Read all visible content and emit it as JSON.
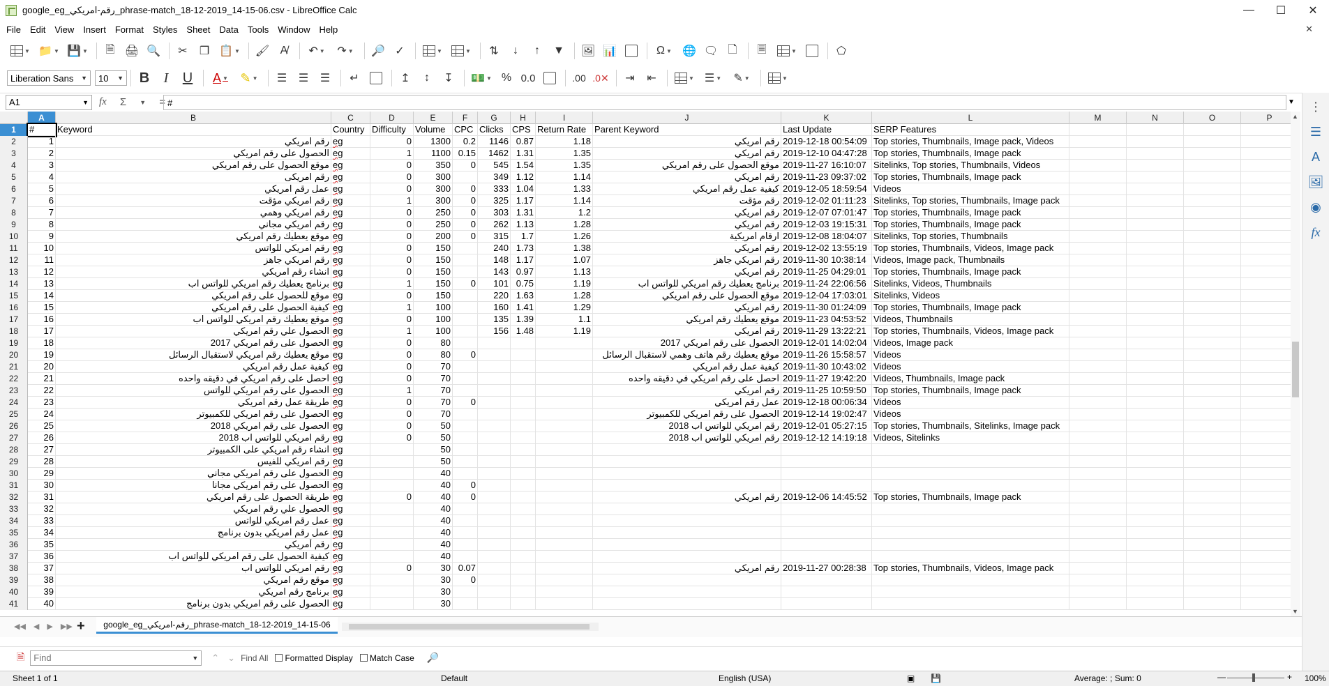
{
  "window": {
    "title": "google_eg_رقم-امريكي_phrase-match_18-12-2019_14-15-06.csv - LibreOffice Calc"
  },
  "menu": [
    "File",
    "Edit",
    "View",
    "Insert",
    "Format",
    "Styles",
    "Sheet",
    "Data",
    "Tools",
    "Window",
    "Help"
  ],
  "formatting": {
    "font_name": "Liberation Sans",
    "font_size": "10"
  },
  "formula_bar": {
    "cell_ref": "A1",
    "content": "#"
  },
  "columns": [
    {
      "letter": "A",
      "w": 40
    },
    {
      "letter": "B",
      "w": 395
    },
    {
      "letter": "C",
      "w": 56
    },
    {
      "letter": "D",
      "w": 62
    },
    {
      "letter": "E",
      "w": 56
    },
    {
      "letter": "F",
      "w": 36
    },
    {
      "letter": "G",
      "w": 47
    },
    {
      "letter": "H",
      "w": 36
    },
    {
      "letter": "I",
      "w": 82
    },
    {
      "letter": "J",
      "w": 270
    },
    {
      "letter": "K",
      "w": 130
    },
    {
      "letter": "L",
      "w": 283
    },
    {
      "letter": "M",
      "w": 82
    },
    {
      "letter": "N",
      "w": 82
    },
    {
      "letter": "O",
      "w": 82
    },
    {
      "letter": "P",
      "w": 82
    }
  ],
  "header_row": [
    "#",
    "Keyword",
    "Country",
    "Difficulty",
    "Volume",
    "CPC",
    "Clicks",
    "CPS",
    "Return Rate",
    "Parent Keyword",
    "Last Update",
    "SERP Features"
  ],
  "rows": [
    [
      "1",
      "رقم امريكي",
      "eg",
      "0",
      "1300",
      "0.2",
      "1146",
      "0.87",
      "1.18",
      "رقم امريكي",
      "2019-12-18 00:54:09",
      "Top stories, Thumbnails, Image pack, Videos"
    ],
    [
      "2",
      "الحصول على رقم امريكي",
      "eg",
      "1",
      "1100",
      "0.15",
      "1462",
      "1.31",
      "1.35",
      "رقم امريكي",
      "2019-12-10 04:47:28",
      "Top stories, Thumbnails, Image pack"
    ],
    [
      "3",
      "موقع الحصول على رقم امريكي",
      "eg",
      "0",
      "350",
      "0",
      "545",
      "1.54",
      "1.35",
      "موقع الحصول على رقم امريكي",
      "2019-11-27 16:10:07",
      "Sitelinks, Top stories, Thumbnails, Videos"
    ],
    [
      "4",
      "رقم امريكى",
      "eg",
      "0",
      "300",
      "",
      "349",
      "1.12",
      "1.14",
      "رقم امريكي",
      "2019-11-23 09:37:02",
      "Top stories, Thumbnails, Image pack"
    ],
    [
      "5",
      "عمل رقم امريكي",
      "eg",
      "0",
      "300",
      "0",
      "333",
      "1.04",
      "1.33",
      "كيفية عمل رقم امريكي",
      "2019-12-05 18:59:54",
      "Videos"
    ],
    [
      "6",
      "رقم امريكي مؤقت",
      "eg",
      "1",
      "300",
      "0",
      "325",
      "1.17",
      "1.14",
      "رقم مؤقت",
      "2019-12-02 01:11:23",
      "Sitelinks, Top stories, Thumbnails, Image pack"
    ],
    [
      "7",
      "رقم امريكي وهمي",
      "eg",
      "0",
      "250",
      "0",
      "303",
      "1.31",
      "1.2",
      "رقم امريكي",
      "2019-12-07 07:01:47",
      "Top stories, Thumbnails, Image pack"
    ],
    [
      "8",
      "رقم امريكي مجاني",
      "eg",
      "0",
      "250",
      "0",
      "262",
      "1.13",
      "1.28",
      "رقم امريكي",
      "2019-12-03 19:15:31",
      "Top stories, Thumbnails, Image pack"
    ],
    [
      "9",
      "موقع يعطيك رقم امريكي",
      "eg",
      "0",
      "200",
      "0",
      "315",
      "1.7",
      "1.26",
      "ارقام امريكية",
      "2019-12-08 18:04:07",
      "Sitelinks, Top stories, Thumbnails"
    ],
    [
      "10",
      "رقم امريكي للواتس",
      "eg",
      "0",
      "150",
      "",
      "240",
      "1.73",
      "1.38",
      "رقم امريكي",
      "2019-12-02 13:55:19",
      "Top stories, Thumbnails, Videos, Image pack"
    ],
    [
      "11",
      "رقم امريكي جاهز",
      "eg",
      "0",
      "150",
      "",
      "148",
      "1.17",
      "1.07",
      "رقم امريكي جاهز",
      "2019-11-30 10:38:14",
      "Videos, Image pack, Thumbnails"
    ],
    [
      "12",
      "انشاء رقم امريكي",
      "eg",
      "0",
      "150",
      "",
      "143",
      "0.97",
      "1.13",
      "رقم امريكي",
      "2019-11-25 04:29:01",
      "Top stories, Thumbnails, Image pack"
    ],
    [
      "13",
      "برنامج يعطيك رقم امريكي للواتس اب",
      "eg",
      "1",
      "150",
      "0",
      "101",
      "0.75",
      "1.19",
      "برنامج يعطيك رقم امريكي للواتس اب",
      "2019-11-24 22:06:56",
      "Sitelinks, Videos, Thumbnails"
    ],
    [
      "14",
      "موقع للحصول على رقم امريكي",
      "eg",
      "0",
      "150",
      "",
      "220",
      "1.63",
      "1.28",
      "موقع الحصول على رقم امريكي",
      "2019-12-04 17:03:01",
      "Sitelinks, Videos"
    ],
    [
      "15",
      "كيفية الحصول على رقم امريكي",
      "eg",
      "1",
      "100",
      "",
      "160",
      "1.41",
      "1.29",
      "رقم امريكي",
      "2019-11-30 01:24:09",
      "Top stories, Thumbnails, Image pack"
    ],
    [
      "16",
      "موقع يعطيك رقم امريكي للواتس اب",
      "eg",
      "0",
      "100",
      "",
      "135",
      "1.39",
      "1.1",
      "موقع يعطيك رقم امريكي",
      "2019-11-23 04:53:52",
      "Videos, Thumbnails"
    ],
    [
      "17",
      "الحصول علي رقم امريكي",
      "eg",
      "1",
      "100",
      "",
      "156",
      "1.48",
      "1.19",
      "رقم امريكي",
      "2019-11-29 13:22:21",
      "Top stories, Thumbnails, Videos, Image pack"
    ],
    [
      "18",
      "الحصول على رقم امريكي 2017",
      "eg",
      "0",
      "80",
      "",
      "",
      "",
      "",
      "الحصول على رقم امريكي 2017",
      "2019-12-01 14:02:04",
      "Videos, Image pack"
    ],
    [
      "19",
      "موقع يعطيك رقم امريكي لاستقبال الرسائل",
      "eg",
      "0",
      "80",
      "0",
      "",
      "",
      "",
      "موقع يعطيك رقم هاتف وهمي لاستقبال الرسائل",
      "2019-11-26 15:58:57",
      "Videos"
    ],
    [
      "20",
      "كيفية عمل رقم امريكي",
      "eg",
      "0",
      "70",
      "",
      "",
      "",
      "",
      "كيفية عمل رقم امريكي",
      "2019-11-30 10:43:02",
      "Videos"
    ],
    [
      "21",
      "احصل على رقم امريكي في دقيقه واحده",
      "eg",
      "0",
      "70",
      "",
      "",
      "",
      "",
      "احصل على رقم امريكي في دقيقه واحده",
      "2019-11-27 19:42:20",
      "Videos, Thumbnails, Image pack"
    ],
    [
      "22",
      "الحصول على رقم امريكي للواتس",
      "eg",
      "1",
      "70",
      "",
      "",
      "",
      "",
      "رقم امريكي",
      "2019-11-25 10:59:50",
      "Top stories, Thumbnails, Image pack"
    ],
    [
      "23",
      "طريقة عمل رقم امريكي",
      "eg",
      "0",
      "70",
      "0",
      "",
      "",
      "",
      "عمل رقم امريكي",
      "2019-12-18 00:06:34",
      "Videos"
    ],
    [
      "24",
      "الحصول على رقم امريكي للكمبيوتر",
      "eg",
      "0",
      "70",
      "",
      "",
      "",
      "",
      "الحصول على رقم امريكي للكمبيوتر",
      "2019-12-14 19:02:47",
      "Videos"
    ],
    [
      "25",
      "الحصول على رقم امريكي 2018",
      "eg",
      "0",
      "50",
      "",
      "",
      "",
      "",
      "رقم امريكي للواتس اب 2018",
      "2019-12-01 05:27:15",
      "Top stories, Thumbnails, Sitelinks, Image pack"
    ],
    [
      "26",
      "رقم امريكي للواتس اب 2018",
      "eg",
      "0",
      "50",
      "",
      "",
      "",
      "",
      "رقم امريكي للواتس اب 2018",
      "2019-12-12 14:19:18",
      "Videos, Sitelinks"
    ],
    [
      "27",
      "انشاء رقم امريكي على الكمبيوتر",
      "eg",
      "",
      "50",
      "",
      "",
      "",
      "",
      "",
      "",
      ""
    ],
    [
      "28",
      "رقم امريكي للفيس",
      "eg",
      "",
      "50",
      "",
      "",
      "",
      "",
      "",
      "",
      ""
    ],
    [
      "29",
      "الحصول على رقم امريكي مجاني",
      "eg",
      "",
      "40",
      "",
      "",
      "",
      "",
      "",
      "",
      ""
    ],
    [
      "30",
      "الحصول على رقم امريكي مجانا",
      "eg",
      "",
      "40",
      "0",
      "",
      "",
      "",
      "",
      "",
      ""
    ],
    [
      "31",
      "طريقة الحصول على رقم امريكي",
      "eg",
      "0",
      "40",
      "0",
      "",
      "",
      "",
      "رقم امريكي",
      "2019-12-06 14:45:52",
      "Top stories, Thumbnails, Image pack"
    ],
    [
      "32",
      "الحصول علي رقم امريكي",
      "eg",
      "",
      "40",
      "",
      "",
      "",
      "",
      "",
      "",
      ""
    ],
    [
      "33",
      "عمل رقم امريكي للواتس",
      "eg",
      "",
      "40",
      "",
      "",
      "",
      "",
      "",
      "",
      ""
    ],
    [
      "34",
      "عمل رقم امريكي بدون برنامج",
      "eg",
      "",
      "40",
      "",
      "",
      "",
      "",
      "",
      "",
      ""
    ],
    [
      "35",
      "رقم أمريكي",
      "eg",
      "",
      "40",
      "",
      "",
      "",
      "",
      "",
      "",
      ""
    ],
    [
      "36",
      "كيفية الحصول على رقم امريكي للواتس اب",
      "eg",
      "",
      "40",
      "",
      "",
      "",
      "",
      "",
      "",
      ""
    ],
    [
      "37",
      "رقم امريكي للواتس اب",
      "eg",
      "0",
      "30",
      "0.07",
      "",
      "",
      "",
      "رقم امريكي",
      "2019-11-27 00:28:38",
      "Top stories, Thumbnails, Videos, Image pack"
    ],
    [
      "38",
      "موقع رقم امريكي",
      "eg",
      "",
      "30",
      "0",
      "",
      "",
      "",
      "",
      "",
      ""
    ],
    [
      "39",
      "برنامج رقم امريكي",
      "eg",
      "",
      "30",
      "",
      "",
      "",
      "",
      "",
      "",
      ""
    ],
    [
      "40",
      "الحصول على رقم امريكي بدون برنامج",
      "eg",
      "",
      "30",
      "",
      "",
      "",
      "",
      "",
      "",
      ""
    ]
  ],
  "sheet_tab": "google_eg_رقم-امريكي_phrase-match_18-12-2019_14-15-06",
  "find": {
    "placeholder": "Find",
    "find_all": "Find All",
    "formatted_display": "Formatted Display",
    "match_case": "Match Case"
  },
  "status": {
    "sheet": "Sheet 1 of 1",
    "style": "Default",
    "language": "English (USA)",
    "summary": "Average: ; Sum: 0",
    "zoom": "100%"
  }
}
